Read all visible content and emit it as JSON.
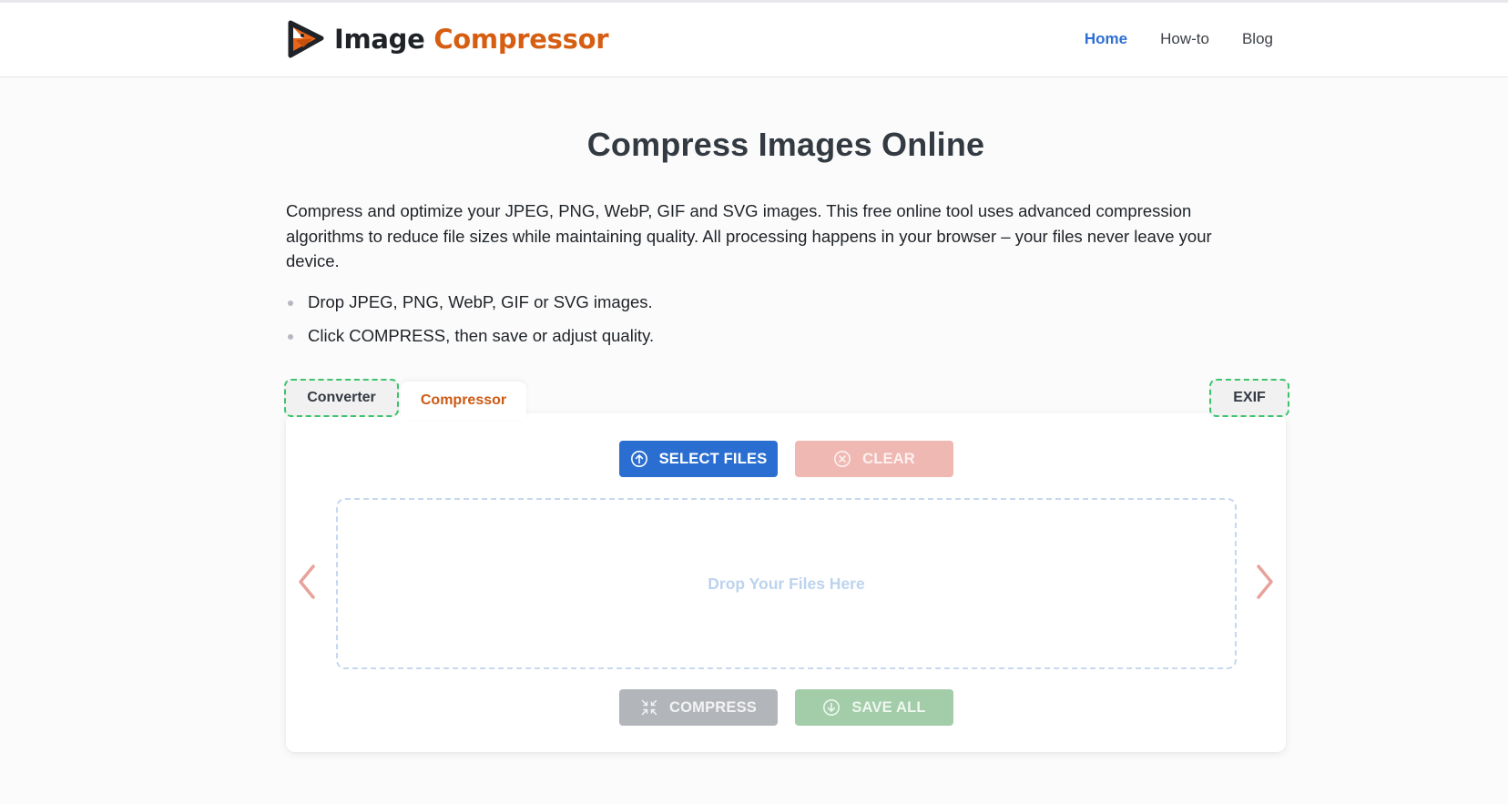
{
  "header": {
    "logo_word1": "Image",
    "logo_word2": "Compressor",
    "nav": [
      {
        "label": "Home",
        "active": true
      },
      {
        "label": "How-to",
        "active": false
      },
      {
        "label": "Blog",
        "active": false
      }
    ]
  },
  "main": {
    "title": "Compress Images Online",
    "intro": "Compress and optimize your JPEG, PNG, WebP, GIF and SVG images. This free online tool uses advanced compression algorithms to reduce file sizes while maintaining quality. All processing happens in your browser – your files never leave your device.",
    "steps": [
      "Drop JPEG, PNG, WebP, GIF or SVG images.",
      "Click COMPRESS, then save or adjust quality."
    ]
  },
  "tool": {
    "tabs": {
      "converter": "Converter",
      "compressor": "Compressor",
      "exif": "EXIF"
    },
    "active_tab": "Compressor",
    "buttons": {
      "select_files": "SELECT FILES",
      "clear": "CLEAR",
      "compress": "COMPRESS",
      "save_all": "SAVE ALL"
    },
    "dropzone_text": "Drop Your Files Here"
  },
  "colors": {
    "brand_orange": "#d65e12",
    "primary_blue": "#2a6ed1",
    "clear_disabled": "#efb8b3",
    "compress_disabled": "#b2b5b9",
    "save_disabled": "#a3cca9",
    "arrow": "#e7a39b"
  },
  "icons": {
    "logo": "fox-play-logo-icon",
    "select": "upload-circle-icon",
    "clear": "close-circle-icon",
    "compress": "compress-arrows-icon",
    "save": "download-circle-icon",
    "prev": "chevron-left-icon",
    "next": "chevron-right-icon"
  }
}
